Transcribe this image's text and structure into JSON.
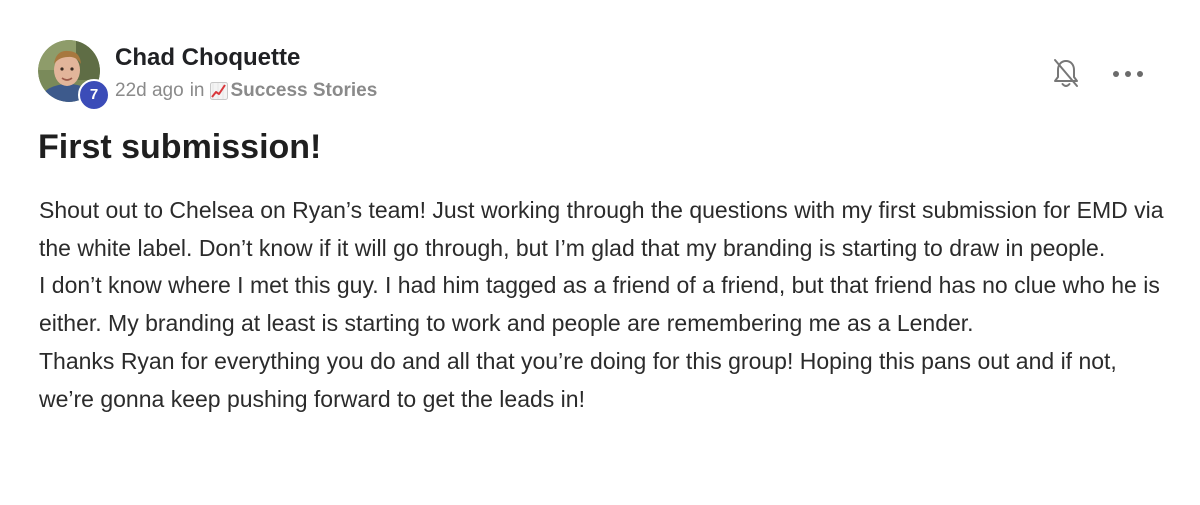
{
  "post": {
    "author": {
      "name": "Chad Choquette",
      "level": "7",
      "avatar_icon": "user-avatar-photo"
    },
    "meta": {
      "time_ago": "22d ago",
      "in_label": "in",
      "category_icon": "chart-increasing-emoji",
      "category": "Success Stories"
    },
    "actions": {
      "notifications_icon": "bell-off-icon",
      "more_icon": "more-horizontal-icon"
    },
    "title": "First submission!",
    "paragraphs": [
      "Shout out to Chelsea on Ryan’s team! Just working through the questions with my first submission for EMD via the white label. Don’t know if it will go through, but I’m glad that my branding is starting to draw in people.",
      "I don’t know where I met this guy. I had him tagged as a friend of a friend, but that friend has no clue who he is either. My branding at least is starting to work and people are remembering me as a Lender.",
      "Thanks Ryan for everything you do and all that you’re doing for this group! Hoping this pans out and if not, we’re gonna keep pushing forward to get the leads in!"
    ]
  },
  "colors": {
    "badge": "#3b4cb8",
    "meta_text": "#8a8a8a",
    "title_text": "#1f1f1f"
  }
}
